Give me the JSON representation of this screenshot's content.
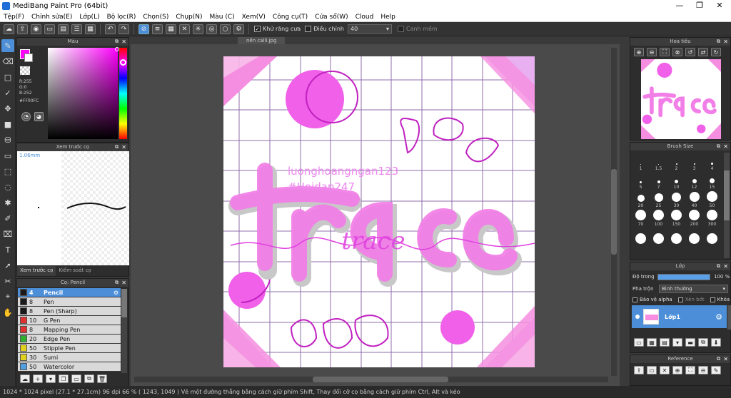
{
  "window": {
    "title": "MediBang Paint Pro (64bit)",
    "minimize": "—",
    "maximize": "❐",
    "close": "✕"
  },
  "menu": [
    "Tệp(F)",
    "Chỉnh sửa(E)",
    "Lớp(L)",
    "Bộ lọc(R)",
    "Chọn(S)",
    "Chụp(N)",
    "Màu (C)",
    "Xem(V)",
    "Công cụ(T)",
    "Cửa sổ(W)",
    "Cloud",
    "Help"
  ],
  "toolbar": {
    "antialias_label": "Khử răng cưa",
    "adjust_label": "Điều chỉnh",
    "adjust_value": "40",
    "snap_label": "Canh mềm"
  },
  "document": {
    "tab_title": "nền calli.jpg",
    "watermark_line1": "luonghoangngan123",
    "watermark_line2": "#Hoidap247",
    "script_word": "trace"
  },
  "color_panel": {
    "title": "Màu",
    "r": "R:255",
    "g": "G:0",
    "b": "B:252",
    "hex": "#FF00FC",
    "current_color": "#ff00fc"
  },
  "preview_panel": {
    "title": "Xem trước cọ",
    "size": "1.06mm",
    "tab_preview": "Xem trước cọ",
    "tab_control": "Kiểm soát cọ"
  },
  "brush_panel": {
    "title": "Cọ: Pencil",
    "brushes": [
      {
        "size": "4",
        "name": "Pencil",
        "color": "#1a1a1a"
      },
      {
        "size": "8",
        "name": "Pen",
        "color": "#1a1a1a"
      },
      {
        "size": "8",
        "name": "Pen (Sharp)",
        "color": "#1a1a1a"
      },
      {
        "size": "10",
        "name": "G Pen",
        "color": "#e03030"
      },
      {
        "size": "8",
        "name": "Mapping Pen",
        "color": "#e03030"
      },
      {
        "size": "20",
        "name": "Edge Pen",
        "color": "#30b030"
      },
      {
        "size": "50",
        "name": "Stipple Pen",
        "color": "#e0d020"
      },
      {
        "size": "30",
        "name": "Sumi",
        "color": "#e0d020"
      },
      {
        "size": "50",
        "name": "Watercolor",
        "color": "#50a0e0"
      }
    ]
  },
  "navigator_panel": {
    "title": "Hoa tiêu"
  },
  "brush_size_panel": {
    "title": "Brush Size",
    "sizes": [
      "1",
      "1.5",
      "2",
      "3",
      "4",
      "5",
      "7",
      "10",
      "12",
      "15",
      "20",
      "25",
      "30",
      "40",
      "50",
      "70",
      "100",
      "150",
      "200",
      "300",
      "",
      "",
      "",
      "",
      ""
    ]
  },
  "layer_panel": {
    "title": "Lớp",
    "opacity_label": "Độ trong",
    "opacity_value": "100 %",
    "opacity_fraction": 1.0,
    "blend_label": "Pha trộn",
    "blend_value": "Bình thường",
    "protect_alpha": "Bảo vệ alpha",
    "clipping": "Xén bớt",
    "lock": "Khóa",
    "layer_name": "Lớp1"
  },
  "reference_panel": {
    "title": "Reference"
  },
  "status": {
    "text": "1024 * 1024 pixel  (27.1 * 27.1cm)  96 dpi  66 %  ( 1243, 1049 )  Vẽ một đường thẳng bằng cách giữ phím Shift, Thay đổi cỡ cọ bằng cách giữ phím Ctrl, Alt và kéo"
  }
}
